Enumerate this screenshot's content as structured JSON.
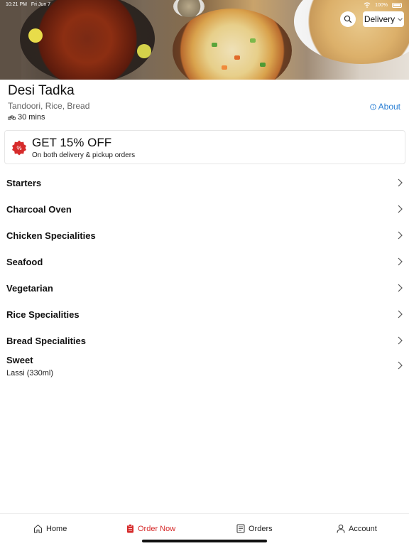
{
  "status_bar": {
    "time": "10:21 PM",
    "date": "Fri Jun 7",
    "battery": "100%"
  },
  "header": {
    "search_icon": "search-icon",
    "delivery_mode": "Delivery"
  },
  "restaurant": {
    "name": "Desi Tadka",
    "cuisines": "Tandoori, Rice, Bread",
    "delivery_time": "30 mins",
    "about_label": "About"
  },
  "offer": {
    "title": "GET 15% OFF",
    "subtitle": "On both delivery & pickup orders",
    "badge_color": "#d62b2b"
  },
  "menu": {
    "categories": [
      {
        "label": "Starters"
      },
      {
        "label": "Charcoal Oven"
      },
      {
        "label": "Chicken Specialities"
      },
      {
        "label": "Seafood"
      },
      {
        "label": "Vegetarian"
      },
      {
        "label": "Rice Specialities"
      },
      {
        "label": "Bread Specialities"
      },
      {
        "label": "Sweet",
        "sub": "Lassi (330ml)"
      }
    ]
  },
  "tabbar": {
    "tabs": [
      {
        "label": "Home",
        "icon": "home-icon"
      },
      {
        "label": "Order Now",
        "icon": "order-icon",
        "active": true
      },
      {
        "label": "Orders",
        "icon": "receipt-icon"
      },
      {
        "label": "Account",
        "icon": "user-icon"
      }
    ],
    "active_color": "#d62b2b"
  }
}
